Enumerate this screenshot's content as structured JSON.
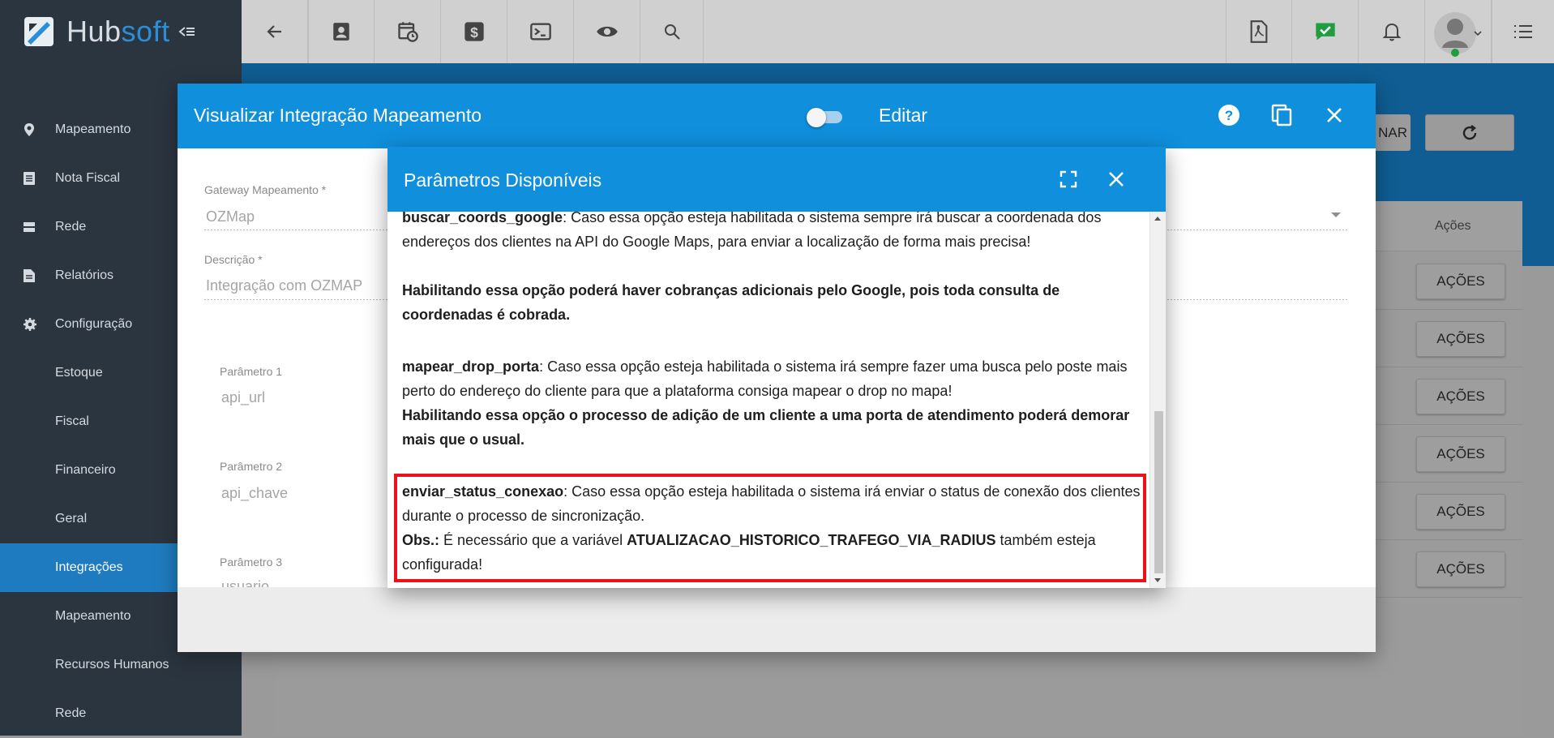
{
  "app": {
    "logo_left": "Hub",
    "logo_right": "soft"
  },
  "sidebar": {
    "items": [
      {
        "label": "Mapeamento",
        "icon": "map-pin-icon"
      },
      {
        "label": "Nota Fiscal",
        "icon": "document-list-icon"
      },
      {
        "label": "Rede",
        "icon": "server-icon"
      },
      {
        "label": "Relatórios",
        "icon": "report-icon"
      },
      {
        "label": "Configuração",
        "icon": "gear-icon"
      }
    ],
    "sub_items": [
      "Estoque",
      "Fiscal",
      "Financeiro",
      "Geral",
      "Integrações",
      "Mapeamento",
      "Recursos Humanos",
      "Rede"
    ]
  },
  "background": {
    "acoes_header": "Ações",
    "acoes_buttons": [
      "AÇÕES",
      "AÇÕES",
      "AÇÕES",
      "AÇÕES",
      "AÇÕES",
      "AÇÕES"
    ],
    "partial_button": "NAR"
  },
  "modal": {
    "title": "Visualizar Integração Mapeamento",
    "edit_label": "Editar",
    "gateway_label": "Gateway Mapeamento *",
    "gateway_value": "OZMap",
    "descricao_label": "Descrição *",
    "descricao_value": "Integração com OZMAP",
    "param1_label": "Parâmetro 1",
    "param1_value": "api_url",
    "param2_label": "Parâmetro 2",
    "param2_value": "api_chave",
    "param3_label": "Parâmetro 3",
    "param3_value": "usuario"
  },
  "params_modal": {
    "title": "Parâmetros Disponíveis",
    "p1_key": "buscar_coords_google",
    "p1_text": ": Caso essa opção esteja habilitada o sistema sempre irá buscar a coordenada dos endereços dos clientes na API do Google Maps, para enviar a localização de forma mais precisa!",
    "p1_warning": "Habilitando essa opção poderá haver cobranças adicionais pelo Google, pois toda consulta de coordenadas é cobrada.",
    "p2_key": "mapear_drop_porta",
    "p2_text": ": Caso essa opção esteja habilitada o sistema irá sempre fazer uma busca pelo poste mais perto do endereço do cliente para que a plataforma consiga mapear o drop no mapa!",
    "p2_warning": "Habilitando essa opção o processo de adição de um cliente a uma porta de atendimento poderá demorar mais que o usual.",
    "p3_key": "enviar_status_conexao",
    "p3_text": ": Caso essa opção esteja habilitada o sistema irá enviar o status de conexão dos clientes durante o processo de sincronização.",
    "p3_obs_label": "Obs.:",
    "p3_obs_text_1": " É necessário que a variável ",
    "p3_obs_var": "ATUALIZACAO_HISTORICO_TRAFEGO_VIA_RADIUS",
    "p3_obs_text_2": " também esteja configurada!"
  }
}
